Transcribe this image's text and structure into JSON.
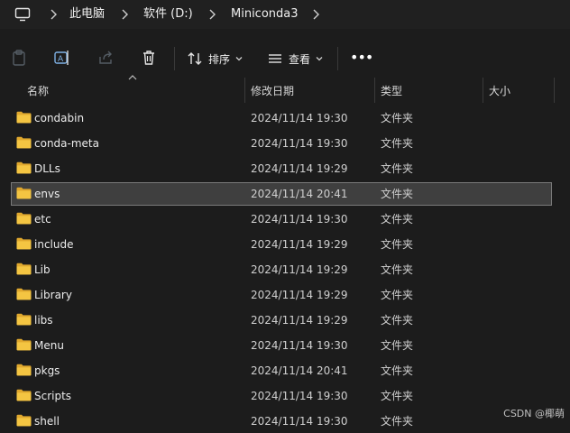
{
  "breadcrumb": {
    "items": [
      "此电脑",
      "软件 (D:)",
      "Miniconda3"
    ]
  },
  "toolbar": {
    "sort_label": "排序",
    "view_label": "查看",
    "more_label": "•••"
  },
  "columns": {
    "name": "名称",
    "date": "修改日期",
    "type": "类型",
    "size": "大小"
  },
  "rows": [
    {
      "name": "condabin",
      "date": "2024/11/14 19:30",
      "type": "文件夹"
    },
    {
      "name": "conda-meta",
      "date": "2024/11/14 19:30",
      "type": "文件夹"
    },
    {
      "name": "DLLs",
      "date": "2024/11/14 19:29",
      "type": "文件夹"
    },
    {
      "name": "envs",
      "date": "2024/11/14 20:41",
      "type": "文件夹",
      "selected": true
    },
    {
      "name": "etc",
      "date": "2024/11/14 19:30",
      "type": "文件夹"
    },
    {
      "name": "include",
      "date": "2024/11/14 19:29",
      "type": "文件夹"
    },
    {
      "name": "Lib",
      "date": "2024/11/14 19:29",
      "type": "文件夹"
    },
    {
      "name": "Library",
      "date": "2024/11/14 19:29",
      "type": "文件夹"
    },
    {
      "name": "libs",
      "date": "2024/11/14 19:29",
      "type": "文件夹"
    },
    {
      "name": "Menu",
      "date": "2024/11/14 19:30",
      "type": "文件夹"
    },
    {
      "name": "pkgs",
      "date": "2024/11/14 20:41",
      "type": "文件夹"
    },
    {
      "name": "Scripts",
      "date": "2024/11/14 19:30",
      "type": "文件夹"
    },
    {
      "name": "shell",
      "date": "2024/11/14 19:30",
      "type": "文件夹"
    }
  ],
  "watermark": "CSDN @椰萌",
  "colors": {
    "background": "#1c1c1c",
    "folder": "#f4c542",
    "selection": "#3f3f3f"
  }
}
